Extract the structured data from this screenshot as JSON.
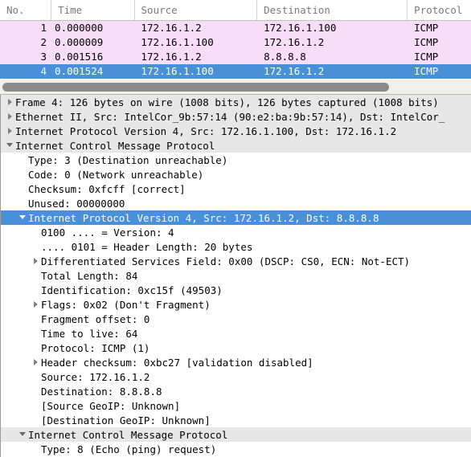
{
  "packet_list": {
    "columns": [
      {
        "key": "no",
        "label": "No."
      },
      {
        "key": "time",
        "label": "Time"
      },
      {
        "key": "source",
        "label": "Source"
      },
      {
        "key": "destination",
        "label": "Destination"
      },
      {
        "key": "protocol",
        "label": "Protocol"
      }
    ],
    "rows": [
      {
        "no": "1",
        "time": "0.000000",
        "source": "172.16.1.2",
        "destination": "172.16.1.100",
        "protocol": "ICMP",
        "selected": false
      },
      {
        "no": "2",
        "time": "0.000009",
        "source": "172.16.1.100",
        "destination": "172.16.1.2",
        "protocol": "ICMP",
        "selected": false
      },
      {
        "no": "3",
        "time": "0.001516",
        "source": "172.16.1.2",
        "destination": "8.8.8.8",
        "protocol": "ICMP",
        "selected": false
      },
      {
        "no": "4",
        "time": "0.001524",
        "source": "172.16.1.100",
        "destination": "172.16.1.2",
        "protocol": "ICMP",
        "selected": true
      }
    ]
  },
  "scrollbar": {
    "orientation": "horizontal",
    "thumb_label": "horizontal-scroll-thumb"
  },
  "detail_tree": [
    {
      "text": "Frame 4: 126 bytes on wire (1008 bits), 126 bytes captured (1008 bits)",
      "indent": 0,
      "toggle": "right",
      "style": "toplevel"
    },
    {
      "text": "Ethernet II, Src: IntelCor_9b:57:14 (90:e2:ba:9b:57:14), Dst: IntelCor_",
      "indent": 0,
      "toggle": "right",
      "style": "toplevel"
    },
    {
      "text": "Internet Protocol Version 4, Src: 172.16.1.100, Dst: 172.16.1.2",
      "indent": 0,
      "toggle": "right",
      "style": "toplevel"
    },
    {
      "text": "Internet Control Message Protocol",
      "indent": 0,
      "toggle": "down",
      "style": "toplevel"
    },
    {
      "text": "Type: 3 (Destination unreachable)",
      "indent": 1,
      "toggle": "none",
      "style": "plain"
    },
    {
      "text": "Code: 0 (Network unreachable)",
      "indent": 1,
      "toggle": "none",
      "style": "plain"
    },
    {
      "text": "Checksum: 0xfcff [correct]",
      "indent": 1,
      "toggle": "none",
      "style": "plain"
    },
    {
      "text": "Unused: 00000000",
      "indent": 1,
      "toggle": "none",
      "style": "plain"
    },
    {
      "text": "Internet Protocol Version 4, Src: 172.16.1.2, Dst: 8.8.8.8",
      "indent": 1,
      "toggle": "down",
      "style": "selected"
    },
    {
      "text": "0100 .... = Version: 4",
      "indent": 2,
      "toggle": "none",
      "style": "plain"
    },
    {
      "text": ".... 0101 = Header Length: 20 bytes",
      "indent": 2,
      "toggle": "none",
      "style": "plain"
    },
    {
      "text": "Differentiated Services Field: 0x00 (DSCP: CS0, ECN: Not-ECT)",
      "indent": 2,
      "toggle": "right",
      "style": "plain"
    },
    {
      "text": "Total Length: 84",
      "indent": 2,
      "toggle": "none",
      "style": "plain"
    },
    {
      "text": "Identification: 0xc15f (49503)",
      "indent": 2,
      "toggle": "none",
      "style": "plain"
    },
    {
      "text": "Flags: 0x02 (Don't Fragment)",
      "indent": 2,
      "toggle": "right",
      "style": "plain"
    },
    {
      "text": "Fragment offset: 0",
      "indent": 2,
      "toggle": "none",
      "style": "plain"
    },
    {
      "text": "Time to live: 64",
      "indent": 2,
      "toggle": "none",
      "style": "plain"
    },
    {
      "text": "Protocol: ICMP (1)",
      "indent": 2,
      "toggle": "none",
      "style": "plain"
    },
    {
      "text": "Header checksum: 0xbc27 [validation disabled]",
      "indent": 2,
      "toggle": "right",
      "style": "plain"
    },
    {
      "text": "Source: 172.16.1.2",
      "indent": 2,
      "toggle": "none",
      "style": "plain"
    },
    {
      "text": "Destination: 8.8.8.8",
      "indent": 2,
      "toggle": "none",
      "style": "plain"
    },
    {
      "text": "[Source GeoIP: Unknown]",
      "indent": 2,
      "toggle": "none",
      "style": "plain"
    },
    {
      "text": "[Destination GeoIP: Unknown]",
      "indent": 2,
      "toggle": "none",
      "style": "plain"
    },
    {
      "text": "Internet Control Message Protocol",
      "indent": 1,
      "toggle": "down",
      "style": "toplevel"
    },
    {
      "text": "Type: 8 (Echo (ping) request)",
      "indent": 2,
      "toggle": "none",
      "style": "plain"
    }
  ],
  "colors": {
    "row_pink": "#f8ddf8",
    "selection_blue": "#4a90d9",
    "toplevel_gray": "#e7e7e7",
    "header_text": "#7a7a7a",
    "scrollbar_thumb": "#8c8c8c"
  }
}
